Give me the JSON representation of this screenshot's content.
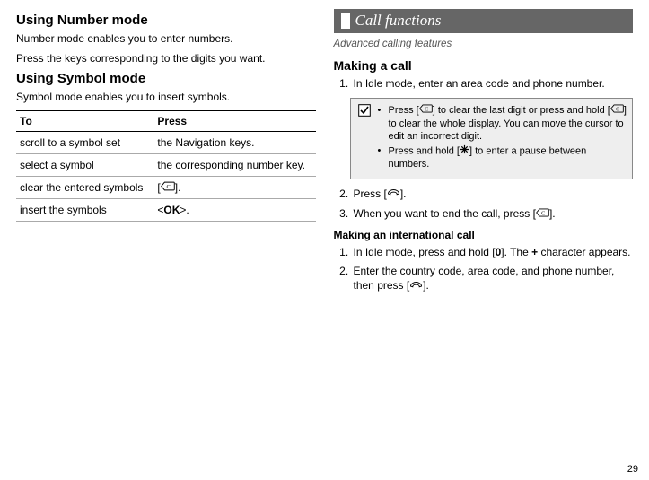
{
  "page_number": "29",
  "left": {
    "h1a": "Using Number mode",
    "p1": "Number mode enables you to enter numbers.",
    "p2": "Press the keys corresponding to the digits you want.",
    "h1b": "Using Symbol mode",
    "p3": "Symbol mode enables you to insert symbols.",
    "table": {
      "head_to": "To",
      "head_press": "Press",
      "rows": [
        {
          "to": "scroll to a symbol set",
          "press": "the Navigation keys."
        },
        {
          "to": "select a symbol",
          "press": "the corresponding number key."
        },
        {
          "to": "clear the entered symbols",
          "press_prefix": "[",
          "press_icon": "clear",
          "press_suffix": "]."
        },
        {
          "to": "insert the symbols",
          "press_prefix": "<",
          "press_ok": "OK",
          "press_suffix": ">."
        }
      ]
    }
  },
  "right": {
    "banner": "Call functions",
    "subtitle": "Advanced calling features",
    "h2a": "Making a call",
    "step1": "In Idle mode, enter an area code and phone number.",
    "tip": {
      "b1a": "Press [",
      "b1b": "] to clear the last digit or press and hold [",
      "b1c": "] to clear the whole display. You can move the cursor to edit an incorrect digit.",
      "b2a": "Press and hold [",
      "b2b": "] to enter a pause between numbers."
    },
    "step2a": "Press [",
    "step2b": "].",
    "step3a": "When you want to end the call, press [",
    "step3b": "].",
    "h3a": "Making an international call",
    "intl1a": "In Idle mode, press and hold [",
    "intl1_zero": "0",
    "intl1b": "]. The ",
    "intl1_plus": "+",
    "intl1c": " character appears.",
    "intl2a": "Enter the country code, area code, and phone number, then press [",
    "intl2b": "]."
  },
  "icons": {
    "clear_c_label": "C"
  }
}
